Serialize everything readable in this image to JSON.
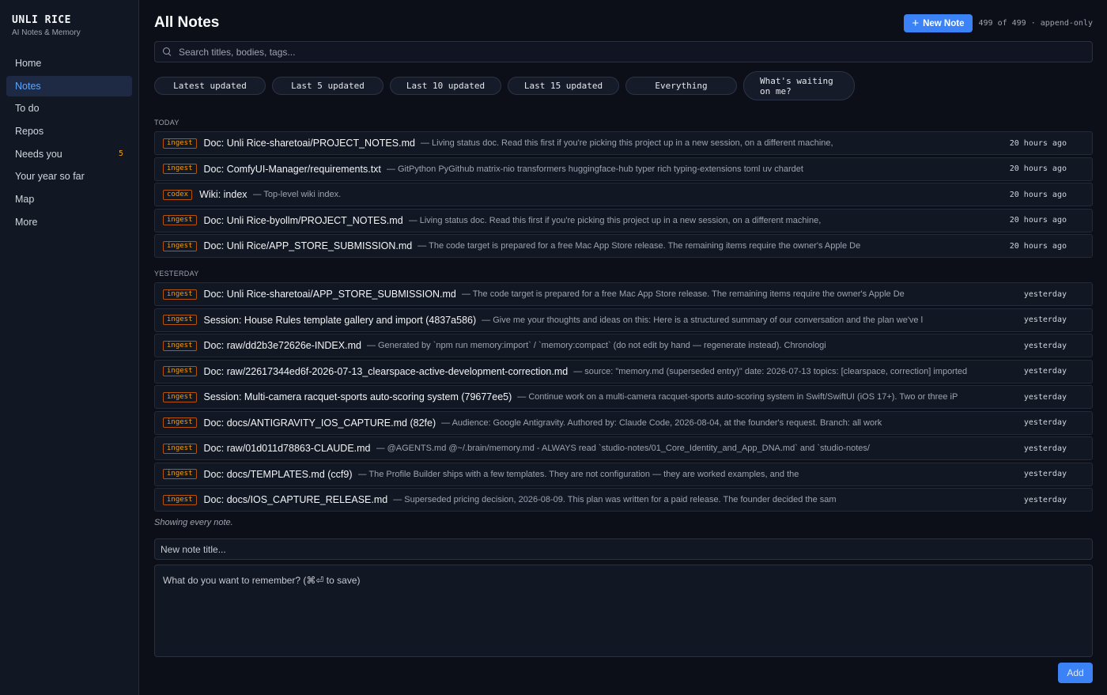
{
  "brand": {
    "title": "UNLI RICE",
    "subtitle": "AI Notes & Memory"
  },
  "nav": [
    {
      "label": "Home",
      "active": false,
      "badge": ""
    },
    {
      "label": "Notes",
      "active": true,
      "badge": ""
    },
    {
      "label": "To do",
      "active": false,
      "badge": ""
    },
    {
      "label": "Repos",
      "active": false,
      "badge": ""
    },
    {
      "label": "Needs you",
      "active": false,
      "badge": "5"
    },
    {
      "label": "Your year so far",
      "active": false,
      "badge": ""
    },
    {
      "label": "Map",
      "active": false,
      "badge": ""
    },
    {
      "label": "More",
      "active": false,
      "badge": ""
    }
  ],
  "header": {
    "title": "All Notes",
    "new_note_label": "New Note",
    "count_text": "499 of 499 · append-only"
  },
  "search": {
    "placeholder": "Search titles, bodies, tags..."
  },
  "filters": [
    "Latest updated",
    "Last 5 updated",
    "Last 10 updated",
    "Last 15 updated",
    "Everything",
    "What's waiting on me?"
  ],
  "sections": [
    {
      "label": "TODAY",
      "rows": [
        {
          "tag": "ingest",
          "title": "Doc: Unli Rice-sharetoai/PROJECT_NOTES.md",
          "snippet": "— Living status doc. Read this first if you're picking this project up in a new session, on a different machine,",
          "time": "20 hours ago"
        },
        {
          "tag": "ingest",
          "title": "Doc: ComfyUI-Manager/requirements.txt",
          "snippet": "— GitPython PyGithub matrix-nio transformers huggingface-hub typer rich typing-extensions toml uv chardet",
          "time": "20 hours ago"
        },
        {
          "tag": "codex",
          "title": "Wiki: index",
          "snippet": "— Top-level wiki index.",
          "time": "20 hours ago"
        },
        {
          "tag": "ingest",
          "title": "Doc: Unli Rice-byollm/PROJECT_NOTES.md",
          "snippet": "— Living status doc. Read this first if you're picking this project up in a new session, on a different machine,",
          "time": "20 hours ago"
        },
        {
          "tag": "ingest",
          "title": "Doc: Unli Rice/APP_STORE_SUBMISSION.md",
          "snippet": "— The code target is prepared for a free Mac App Store release. The remaining items require the owner's Apple De",
          "time": "20 hours ago"
        }
      ]
    },
    {
      "label": "YESTERDAY",
      "rows": [
        {
          "tag": "ingest",
          "title": "Doc: Unli Rice-sharetoai/APP_STORE_SUBMISSION.md",
          "snippet": "— The code target is prepared for a free Mac App Store release. The remaining items require the owner's Apple De",
          "time": "yesterday"
        },
        {
          "tag": "ingest",
          "title": "Session: House Rules template gallery and import (4837a586)",
          "snippet": "— Give me your thoughts and ideas on this: Here is a structured summary of our conversation and the plan we've l",
          "time": "yesterday"
        },
        {
          "tag": "ingest",
          "title": "Doc: raw/dd2b3e72626e-INDEX.md",
          "snippet": "— Generated by `npm run memory:import` / `memory:compact` (do not edit by hand — regenerate instead). Chronologi",
          "time": "yesterday"
        },
        {
          "tag": "ingest",
          "title": "Doc: raw/22617344ed6f-2026-07-13_clearspace-active-development-correction.md",
          "snippet": "— source: \"memory.md (superseded entry)\" date: 2026-07-13 topics: [clearspace, correction] imported",
          "time": "yesterday"
        },
        {
          "tag": "ingest",
          "title": "Session: Multi-camera racquet-sports auto-scoring system (79677ee5)",
          "snippet": "— Continue work on a multi-camera racquet-sports auto-scoring system in Swift/SwiftUI (iOS 17+). Two or three iP",
          "time": "yesterday"
        },
        {
          "tag": "ingest",
          "title": "Doc: docs/ANTIGRAVITY_IOS_CAPTURE.md (82fe)",
          "snippet": "— Audience: Google Antigravity. Authored by: Claude Code, 2026-08-04, at the founder's request. Branch: all work",
          "time": "yesterday"
        },
        {
          "tag": "ingest",
          "title": "Doc: raw/01d011d78863-CLAUDE.md",
          "snippet": "— @AGENTS.md @~/.brain/memory.md - ALWAYS read `studio-notes/01_Core_Identity_and_App_DNA.md` and `studio-notes/",
          "time": "yesterday"
        },
        {
          "tag": "ingest",
          "title": "Doc: docs/TEMPLATES.md (ccf9)",
          "snippet": "— The Profile Builder ships with a few templates. They are not configuration — they are worked examples, and the",
          "time": "yesterday"
        },
        {
          "tag": "ingest",
          "title": "Doc: docs/IOS_CAPTURE_RELEASE.md",
          "snippet": "— Superseded pricing decision, 2026-08-09. This plan was written for a paid release. The founder decided the sam",
          "time": "yesterday"
        }
      ]
    }
  ],
  "footer": {
    "showing_text": "Showing every note.",
    "title_placeholder": "New note title...",
    "body_placeholder": "What do you want to remember? (⌘⏎ to save)",
    "add_label": "Add"
  },
  "colors": {
    "accent": "#3b82f6",
    "tag": "#f59e0b",
    "background": "#0c0f18",
    "sidebar": "#121724"
  },
  "icons": {
    "search": "search-icon",
    "new_note": "plus-icon"
  }
}
